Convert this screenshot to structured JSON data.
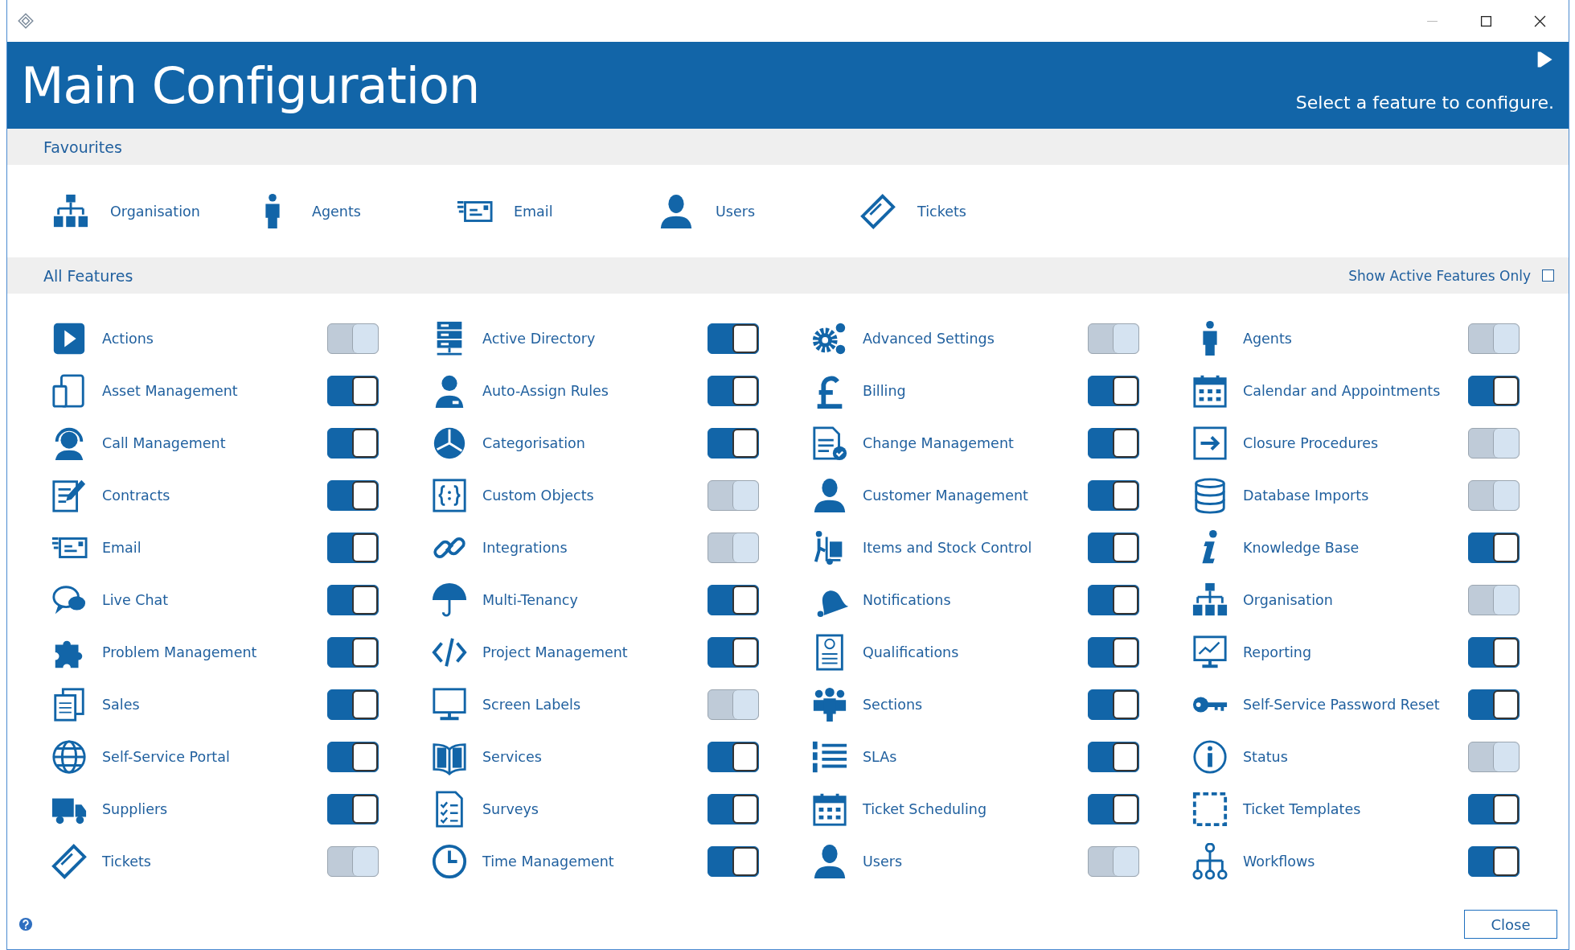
{
  "header": {
    "title": "Main Configuration",
    "subtitle": "Select a feature to configure."
  },
  "favourites": {
    "heading": "Favourites",
    "items": [
      {
        "label": "Organisation"
      },
      {
        "label": "Agents"
      },
      {
        "label": "Email"
      },
      {
        "label": "Users"
      },
      {
        "label": "Tickets"
      }
    ]
  },
  "all_features": {
    "heading": "All Features",
    "filter": {
      "label": "Show Active Features Only",
      "checked": false
    },
    "columns": [
      [
        {
          "label": "Actions",
          "disabled": true
        },
        {
          "label": "Asset Management",
          "disabled": false
        },
        {
          "label": "Call Management",
          "disabled": false
        },
        {
          "label": "Contracts",
          "disabled": false
        },
        {
          "label": "Email",
          "disabled": false
        },
        {
          "label": "Live Chat",
          "disabled": false
        },
        {
          "label": "Problem Management",
          "disabled": false
        },
        {
          "label": "Sales",
          "disabled": false
        },
        {
          "label": "Self-Service Portal",
          "disabled": false
        },
        {
          "label": "Suppliers",
          "disabled": false
        },
        {
          "label": "Tickets",
          "disabled": true
        }
      ],
      [
        {
          "label": "Active Directory",
          "disabled": false
        },
        {
          "label": "Auto-Assign Rules",
          "disabled": false
        },
        {
          "label": "Categorisation",
          "disabled": false
        },
        {
          "label": "Custom Objects",
          "disabled": true
        },
        {
          "label": "Integrations",
          "disabled": true
        },
        {
          "label": "Multi-Tenancy",
          "disabled": false
        },
        {
          "label": "Project Management",
          "disabled": false
        },
        {
          "label": "Screen Labels",
          "disabled": true
        },
        {
          "label": "Services",
          "disabled": false
        },
        {
          "label": "Surveys",
          "disabled": false
        },
        {
          "label": "Time Management",
          "disabled": false
        }
      ],
      [
        {
          "label": "Advanced Settings",
          "disabled": true
        },
        {
          "label": "Billing",
          "disabled": false
        },
        {
          "label": "Change Management",
          "disabled": false
        },
        {
          "label": "Customer Management",
          "disabled": false
        },
        {
          "label": "Items and Stock Control",
          "disabled": false
        },
        {
          "label": "Notifications",
          "disabled": false
        },
        {
          "label": "Qualifications",
          "disabled": false
        },
        {
          "label": "Sections",
          "disabled": false
        },
        {
          "label": "SLAs",
          "disabled": false
        },
        {
          "label": "Ticket Scheduling",
          "disabled": false
        },
        {
          "label": "Users",
          "disabled": true
        }
      ],
      [
        {
          "label": "Agents",
          "disabled": true
        },
        {
          "label": "Calendar and Appointments",
          "disabled": false
        },
        {
          "label": "Closure Procedures",
          "disabled": true
        },
        {
          "label": "Database Imports",
          "disabled": true
        },
        {
          "label": "Knowledge Base",
          "disabled": false
        },
        {
          "label": "Organisation",
          "disabled": true
        },
        {
          "label": "Reporting",
          "disabled": false
        },
        {
          "label": "Self-Service Password Reset",
          "disabled": false
        },
        {
          "label": "Status",
          "disabled": true
        },
        {
          "label": "Ticket Templates",
          "disabled": false
        },
        {
          "label": "Workflows",
          "disabled": false
        }
      ]
    ]
  },
  "footer": {
    "button": "Close"
  }
}
